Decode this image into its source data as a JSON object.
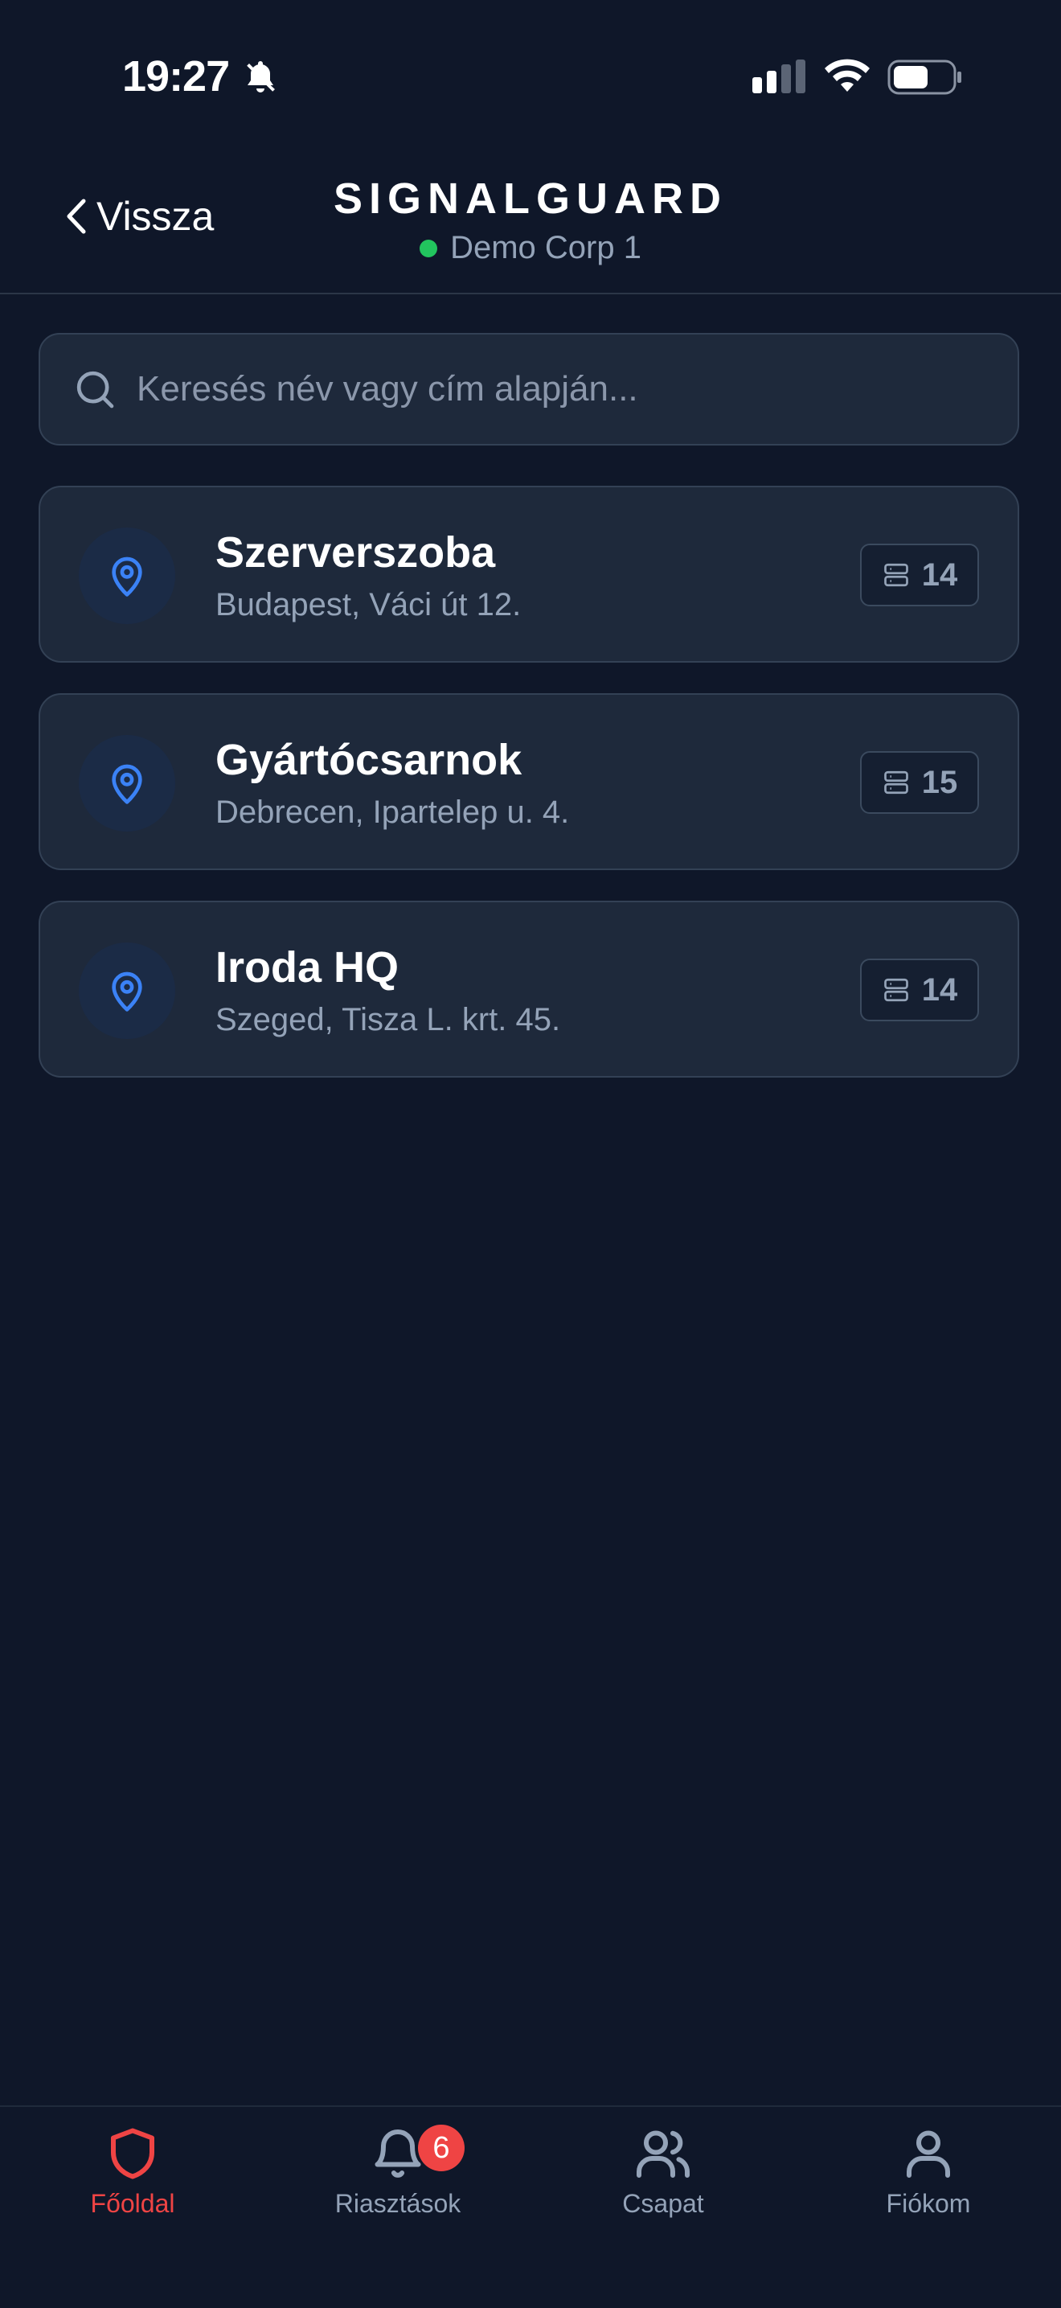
{
  "status_bar": {
    "time": "19:27"
  },
  "header": {
    "back_label": "Vissza",
    "app_title": "SIGNALGUARD",
    "org_name": "Demo Corp 1",
    "org_status_color": "#22c55e"
  },
  "search": {
    "placeholder": "Keresés név vagy cím alapján...",
    "value": ""
  },
  "locations": [
    {
      "name": "Szerverszoba",
      "address": "Budapest, Váci út 12.",
      "device_count": "14"
    },
    {
      "name": "Gyártócsarnok",
      "address": "Debrecen, Ipartelep u. 4.",
      "device_count": "15"
    },
    {
      "name": "Iroda HQ",
      "address": "Szeged, Tisza L. krt. 45.",
      "device_count": "14"
    }
  ],
  "tab_bar": {
    "tabs": [
      {
        "label": "Főoldal",
        "icon": "shield-icon",
        "active": true
      },
      {
        "label": "Riasztások",
        "icon": "bell-icon",
        "badge": "6"
      },
      {
        "label": "Csapat",
        "icon": "users-icon"
      },
      {
        "label": "Fiókom",
        "icon": "user-icon"
      }
    ]
  },
  "colors": {
    "background": "#0f1729",
    "card": "#1e293b",
    "accent": "#ef4444",
    "pin": "#3b82f6"
  }
}
